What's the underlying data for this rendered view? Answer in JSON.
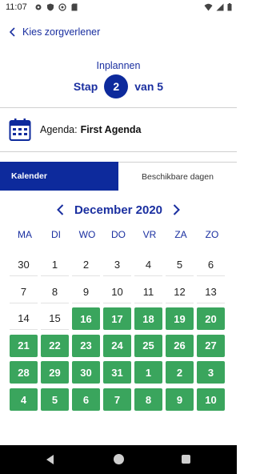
{
  "status_bar": {
    "time": "11:07",
    "left_icons": [
      "settings-icon",
      "shield-icon",
      "at-sign-icon",
      "sd-card-icon"
    ],
    "right_icons": [
      "wifi-icon",
      "signal-icon",
      "battery-icon"
    ]
  },
  "header": {
    "back_label": "Kies zorgverlener"
  },
  "steps": {
    "title": "Inplannen",
    "prefix": "Stap",
    "current": "2",
    "suffix": "van 5"
  },
  "agenda": {
    "label": "Agenda:",
    "value": "First Agenda"
  },
  "tabs": {
    "active": "Kalender",
    "inactive": "Beschikbare dagen"
  },
  "calendar": {
    "month": "December 2020",
    "weekdays": [
      "MA",
      "DI",
      "WO",
      "DO",
      "VR",
      "ZA",
      "ZO"
    ],
    "weeks": [
      [
        {
          "d": "30",
          "a": false
        },
        {
          "d": "1",
          "a": false
        },
        {
          "d": "2",
          "a": false
        },
        {
          "d": "3",
          "a": false
        },
        {
          "d": "4",
          "a": false
        },
        {
          "d": "5",
          "a": false
        },
        {
          "d": "6",
          "a": false
        }
      ],
      [
        {
          "d": "7",
          "a": false
        },
        {
          "d": "8",
          "a": false
        },
        {
          "d": "9",
          "a": false
        },
        {
          "d": "10",
          "a": false
        },
        {
          "d": "11",
          "a": false
        },
        {
          "d": "12",
          "a": false
        },
        {
          "d": "13",
          "a": false
        }
      ],
      [
        {
          "d": "14",
          "a": false
        },
        {
          "d": "15",
          "a": false
        },
        {
          "d": "16",
          "a": true
        },
        {
          "d": "17",
          "a": true
        },
        {
          "d": "18",
          "a": true
        },
        {
          "d": "19",
          "a": true
        },
        {
          "d": "20",
          "a": true
        }
      ],
      [
        {
          "d": "21",
          "a": true
        },
        {
          "d": "22",
          "a": true
        },
        {
          "d": "23",
          "a": true
        },
        {
          "d": "24",
          "a": true
        },
        {
          "d": "25",
          "a": true
        },
        {
          "d": "26",
          "a": true
        },
        {
          "d": "27",
          "a": true
        }
      ],
      [
        {
          "d": "28",
          "a": true
        },
        {
          "d": "29",
          "a": true
        },
        {
          "d": "30",
          "a": true
        },
        {
          "d": "31",
          "a": true
        },
        {
          "d": "1",
          "a": true
        },
        {
          "d": "2",
          "a": true
        },
        {
          "d": "3",
          "a": true
        }
      ],
      [
        {
          "d": "4",
          "a": true
        },
        {
          "d": "5",
          "a": true
        },
        {
          "d": "6",
          "a": true
        },
        {
          "d": "7",
          "a": true
        },
        {
          "d": "8",
          "a": true
        },
        {
          "d": "9",
          "a": true
        },
        {
          "d": "10",
          "a": true
        }
      ]
    ]
  },
  "colors": {
    "brand_blue": "#0d2a9c",
    "available_green": "#3aa55d"
  },
  "nav_bar": {
    "buttons": [
      "back-icon",
      "home-icon",
      "recents-icon"
    ]
  }
}
